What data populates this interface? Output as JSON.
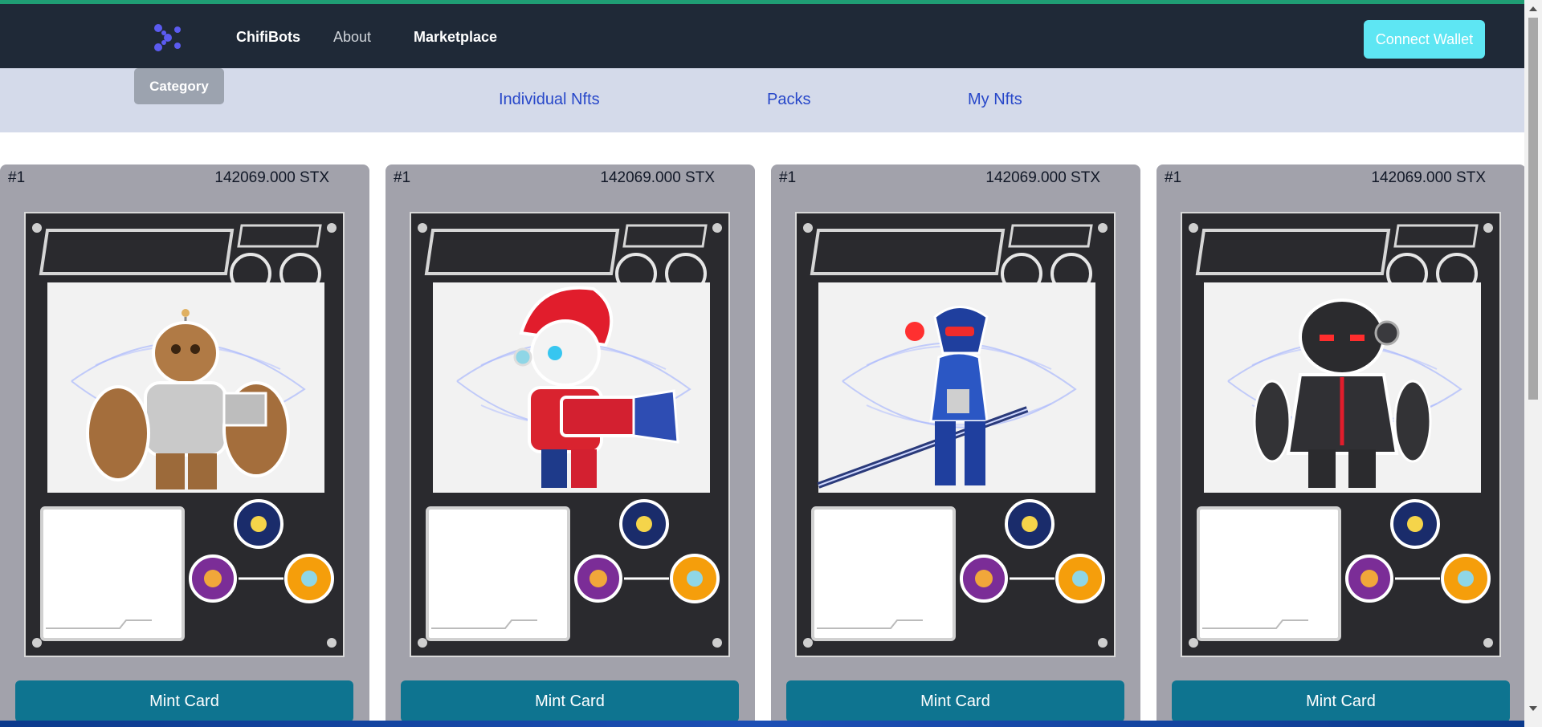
{
  "nav": {
    "logo_icon": "chifi-logo-icon",
    "links": [
      {
        "label": "ChifiBots"
      },
      {
        "label": "About"
      },
      {
        "label": "Marketplace"
      }
    ],
    "connect_label": "Connect Wallet"
  },
  "subnav": {
    "category_label": "Category",
    "links": [
      {
        "label": "Individual Nfts"
      },
      {
        "label": "Packs"
      },
      {
        "label": "My Nfts"
      }
    ]
  },
  "cards": [
    {
      "id": "#1",
      "price": "142069.000 STX",
      "mint_label": "Mint Card",
      "robot": "brown-golem-robot"
    },
    {
      "id": "#1",
      "price": "142069.000 STX",
      "mint_label": "Mint Card",
      "robot": "red-haired-blaster-robot"
    },
    {
      "id": "#1",
      "price": "142069.000 STX",
      "mint_label": "Mint Card",
      "robot": "blue-ninja-robot"
    },
    {
      "id": "#1",
      "price": "142069.000 STX",
      "mint_label": "Mint Card",
      "robot": "black-red-robot"
    }
  ],
  "colors": {
    "navbar": "#1f2937",
    "accent": "#5ee6f3",
    "mint_button": "#0e7490",
    "subnav": "#d4daea",
    "link": "#2747c9"
  }
}
